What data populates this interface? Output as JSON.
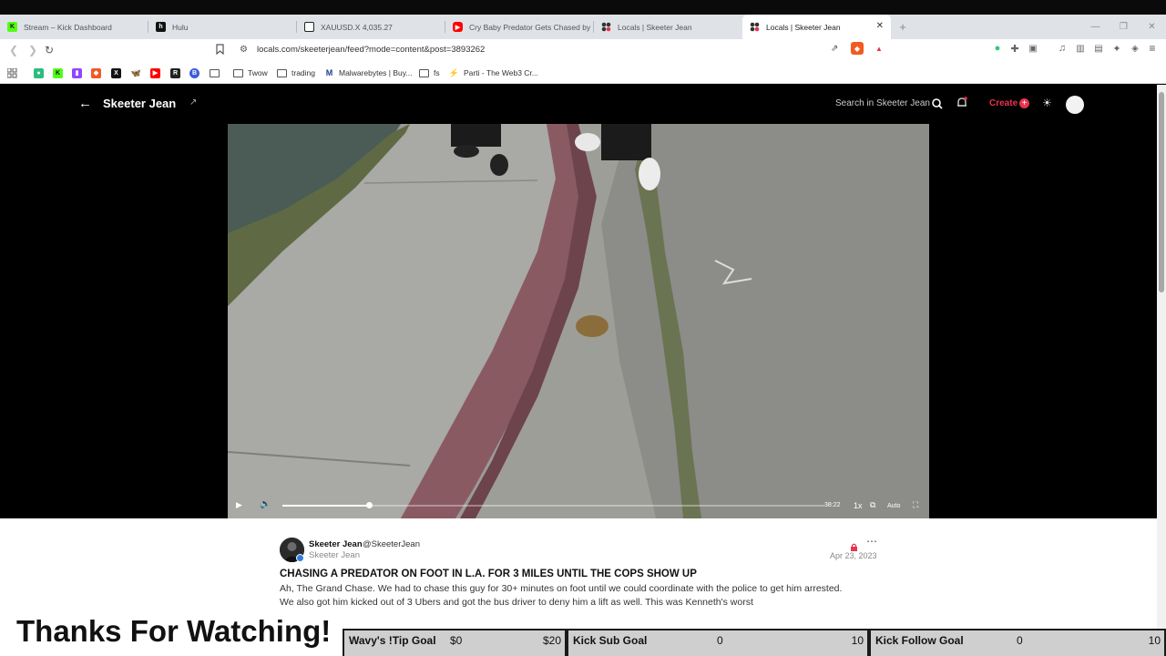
{
  "browser": {
    "tabs": [
      {
        "title": "Stream – Kick Dashboard",
        "color": "#53fc18",
        "glyph": "K"
      },
      {
        "title": "Hulu",
        "color": "#111111",
        "glyph": "h"
      },
      {
        "title": "XAUUSD.X 4,035.27",
        "color": "#222222",
        "glyph": ""
      },
      {
        "title": "Cry Baby Predator Gets Chased by B",
        "color": "#ff0000",
        "glyph": ""
      },
      {
        "title": "Locals | Skeeter Jean",
        "color": "#333333",
        "glyph": ""
      },
      {
        "title": "Locals | Skeeter Jean",
        "color": "#333333",
        "glyph": ""
      }
    ],
    "url": "locals.com/skeeterjean/feed?mode=content&post=3893262",
    "bookmarks": [
      {
        "label": "Twow"
      },
      {
        "label": "trading"
      },
      {
        "label": "Malwarebytes | Buy..."
      },
      {
        "label": "fs"
      },
      {
        "label": "Parti - The Web3 Cr..."
      }
    ]
  },
  "site": {
    "title": "Skeeter Jean",
    "search_placeholder": "Search in Skeeter Jean",
    "create_label": "Create"
  },
  "video": {
    "time": "38:22",
    "speed": "1x",
    "quality": "Auto",
    "progress": 0.16
  },
  "post": {
    "author": "Skeeter Jean",
    "handle": "@SkeeterJean",
    "sub": "Skeeter Jean",
    "date": "Apr 23, 2023",
    "title": "CHASING A PREDATOR ON FOOT IN L.A. FOR 3 MILES UNTIL THE COPS SHOW UP",
    "body": "Ah, The Grand Chase. We had to chase this guy for 30+ minutes on foot until we could coordinate with the police to get him arrested. We also got him kicked out of 3 Ubers and got the bus driver to deny him a lift as well. This was Kenneth's worst"
  },
  "overlay": {
    "thanks": "Thanks For Watching!",
    "goals": [
      {
        "label": "Wavy's !Tip Goal",
        "current": "$0",
        "max": "$20"
      },
      {
        "label": "Kick Sub Goal",
        "current": "0",
        "max": "10"
      },
      {
        "label": "Kick Follow Goal",
        "current": "0",
        "max": "10"
      }
    ]
  }
}
